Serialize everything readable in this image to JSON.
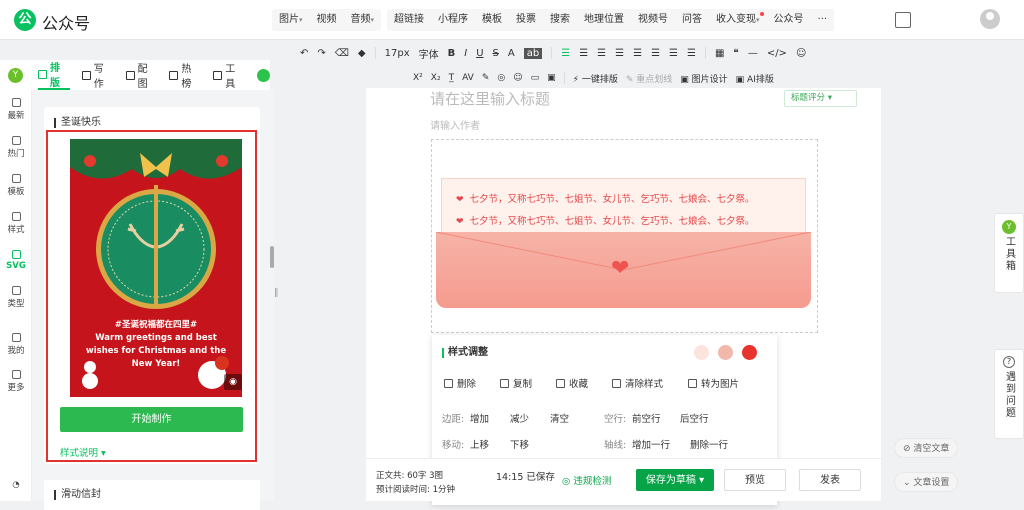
{
  "app": {
    "name": "公众号",
    "logo_letter": "公"
  },
  "topmenu": {
    "group1": [
      {
        "label": "图片",
        "dd": "▾"
      },
      {
        "label": "视频",
        "dd": ""
      },
      {
        "label": "音频",
        "dd": "▾"
      }
    ],
    "group2": [
      "超链接",
      "小程序",
      "模板",
      "投票",
      "搜索",
      "地理位置",
      "视频号",
      "问答"
    ],
    "monetize": "收入变现",
    "monetize_dd": "▾",
    "official": "公众号",
    "more": "···"
  },
  "toolbar1": {
    "undo": "↶",
    "redo": "↷",
    "clear_format": "⌫",
    "paint": "◆",
    "fontsize": "17px",
    "font": "字体",
    "bold": "B",
    "italic": "I",
    "underline": "U",
    "strike": "S",
    "color": "A",
    "bgcolor": "ab",
    "table": "▦",
    "quote": "❝",
    "more": "—",
    "code": "</>",
    "emoji": "☺"
  },
  "toolbar2": {
    "sup": "X²",
    "sub": "X₂",
    "text_spacing": "T̲",
    "letter_spacing": "AV",
    "pen": "✎",
    "paint": "◎",
    "emoji": "☺",
    "img1": "▭",
    "img2": "▣",
    "one_click": "一键排版",
    "highlight": "重点划线",
    "img_design": "图片设计",
    "ai_layout": "AI排版"
  },
  "leftrail": [
    {
      "label": "最新",
      "icon": "latest-icon"
    },
    {
      "label": "热门",
      "icon": "hot-icon"
    },
    {
      "label": "模板",
      "icon": "template-icon"
    },
    {
      "label": "样式",
      "icon": "style-icon"
    },
    {
      "label": "SVG",
      "icon": "svg-icon"
    },
    {
      "label": "类型",
      "icon": "type-icon"
    },
    {
      "label": "我的",
      "icon": "mine-icon"
    },
    {
      "label": "更多",
      "icon": "more-icon"
    }
  ],
  "tabs": [
    {
      "label": "排版"
    },
    {
      "label": "写作"
    },
    {
      "label": "配图"
    },
    {
      "label": "热榜"
    },
    {
      "label": "工具"
    }
  ],
  "panel": {
    "section_title": "圣诞快乐",
    "card_text": [
      "#圣诞祝福都在四里#",
      "Warm greetings and best",
      "wishes for Christmas and the",
      "New Year!"
    ],
    "start_button": "开始制作",
    "style_desc": "样式说明 ▾",
    "next_section": "滑动信封"
  },
  "editor": {
    "title_placeholder": "请在这里输入标题",
    "author_placeholder": "请输入作者",
    "score_button": "标题评分 ▾",
    "envelope_lines": [
      "七夕节，又称七巧节、七姐节、女儿节、乞巧节、七娘会、七夕祭。",
      "七夕节，又称七巧节、七姐节、女儿节、乞巧节、七娘会、七夕祭。"
    ]
  },
  "style_panel": {
    "title": "样式调整",
    "colors": [
      "#fce4dc",
      "#f2b8ac",
      "#e8322e"
    ],
    "actions": [
      "删除",
      "复制",
      "收藏",
      "清除样式",
      "转为图片"
    ],
    "rows": [
      {
        "label": "边距:",
        "items": [
          "增加",
          "减少",
          "清空"
        ],
        "label2": "空行:",
        "items2": [
          "前空行",
          "后空行"
        ]
      },
      {
        "label": "移动:",
        "items": [
          "上移",
          "下移"
        ],
        "label2": "轴线:",
        "items2": [
          "增加一行",
          "删除一行"
        ]
      }
    ]
  },
  "bottom": {
    "word_count_label": "正文共:",
    "word_count": "60字",
    "images": "3图",
    "read_time_label": "预计阅读时间:",
    "read_time": "1分钟",
    "saved": "14:15 已保存",
    "violation": "违规检测",
    "save_draft": "保存为草稿",
    "preview": "预览",
    "publish": "发表"
  },
  "right": {
    "toolbox": "工具箱",
    "issue": "遇到问题",
    "clear_article": "清空文章",
    "article_settings": "文章设置"
  }
}
